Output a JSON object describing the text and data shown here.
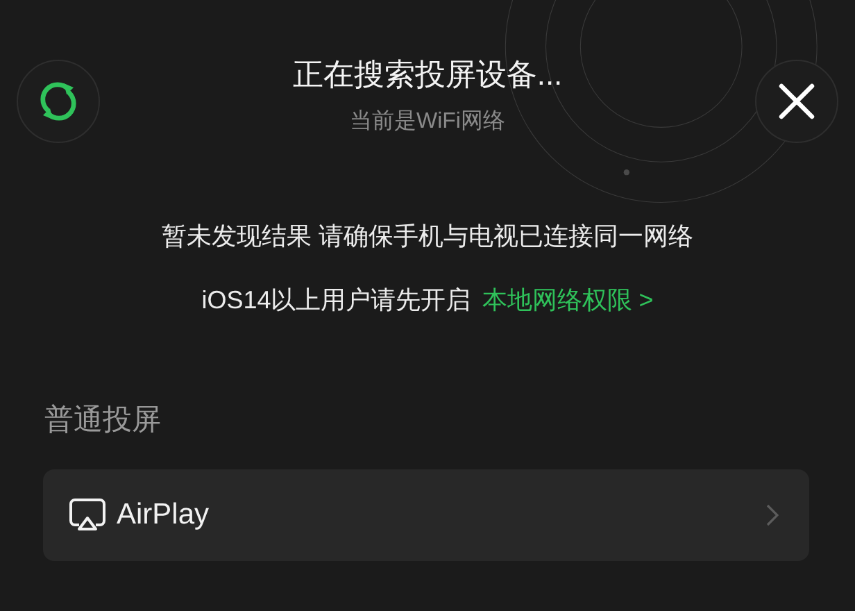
{
  "header": {
    "title": "正在搜索投屏设备...",
    "subtitle": "当前是WiFi网络"
  },
  "message": "暂未发现结果 请确保手机与电视已连接同一网络",
  "notice": {
    "text": "iOS14以上用户请先开启",
    "link": "本地网络权限 >"
  },
  "section": {
    "title": "普通投屏",
    "items": [
      {
        "label": "AirPlay"
      }
    ]
  }
}
